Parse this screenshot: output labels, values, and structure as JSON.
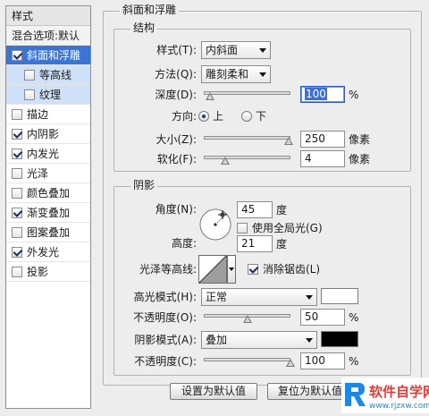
{
  "styles_panel": {
    "title": "样式",
    "blend_options": "混合选项:默认",
    "items": [
      {
        "label": "斜面和浮雕",
        "checked": true
      },
      {
        "label": "等高线",
        "checked": false
      },
      {
        "label": "纹理",
        "checked": false
      },
      {
        "label": "描边",
        "checked": false
      },
      {
        "label": "内阴影",
        "checked": true
      },
      {
        "label": "内发光",
        "checked": true
      },
      {
        "label": "光泽",
        "checked": false
      },
      {
        "label": "颜色叠加",
        "checked": false
      },
      {
        "label": "渐变叠加",
        "checked": true
      },
      {
        "label": "图案叠加",
        "checked": false
      },
      {
        "label": "外发光",
        "checked": true
      },
      {
        "label": "投影",
        "checked": false
      }
    ]
  },
  "bevel": {
    "title": "斜面和浮雕",
    "structure": {
      "title": "结构",
      "style_label": "样式(T):",
      "style_value": "内斜面",
      "technique_label": "方法(Q):",
      "technique_value": "雕刻柔和",
      "depth_label": "深度(D):",
      "depth_value": "100",
      "depth_unit": "%",
      "depth_slider": 0.07,
      "direction_label": "方向:",
      "direction_up": "上",
      "direction_down": "下",
      "size_label": "大小(Z):",
      "size_value": "250",
      "size_unit": "像素",
      "size_slider": 0.98,
      "soften_label": "软化(F):",
      "soften_value": "4",
      "soften_unit": "像素",
      "soften_slider": 0.25
    },
    "shading": {
      "title": "阴影",
      "angle_label": "角度(N):",
      "angle_value": "45",
      "angle_unit": "度",
      "global_light_label": "使用全局光(G)",
      "global_light_checked": false,
      "altitude_label": "高度:",
      "altitude_value": "21",
      "altitude_unit": "度",
      "gloss_contour_label": "光泽等高线:",
      "anti_alias_label": "消除锯齿(L)",
      "anti_alias_checked": true,
      "highlight_mode_label": "高光模式(H):",
      "highlight_mode_value": "正常",
      "highlight_color": "#ffffff",
      "highlight_opacity_label": "不透明度(O):",
      "highlight_opacity_value": "50",
      "highlight_opacity_unit": "%",
      "highlight_opacity_slider": 0.5,
      "shadow_mode_label": "阴影模式(A):",
      "shadow_mode_value": "叠加",
      "shadow_color": "#000000",
      "shadow_opacity_label": "不透明度(C):",
      "shadow_opacity_value": "100",
      "shadow_opacity_unit": "%",
      "shadow_opacity_slider": 1.0
    }
  },
  "buttons": {
    "make_default": "设置为默认值",
    "reset_default": "复位为默认值"
  },
  "watermark": {
    "brand": "软件自学网",
    "url": "www.rjzxw.com",
    "accent": "#1e88e5",
    "brand_color": "#e53935"
  }
}
